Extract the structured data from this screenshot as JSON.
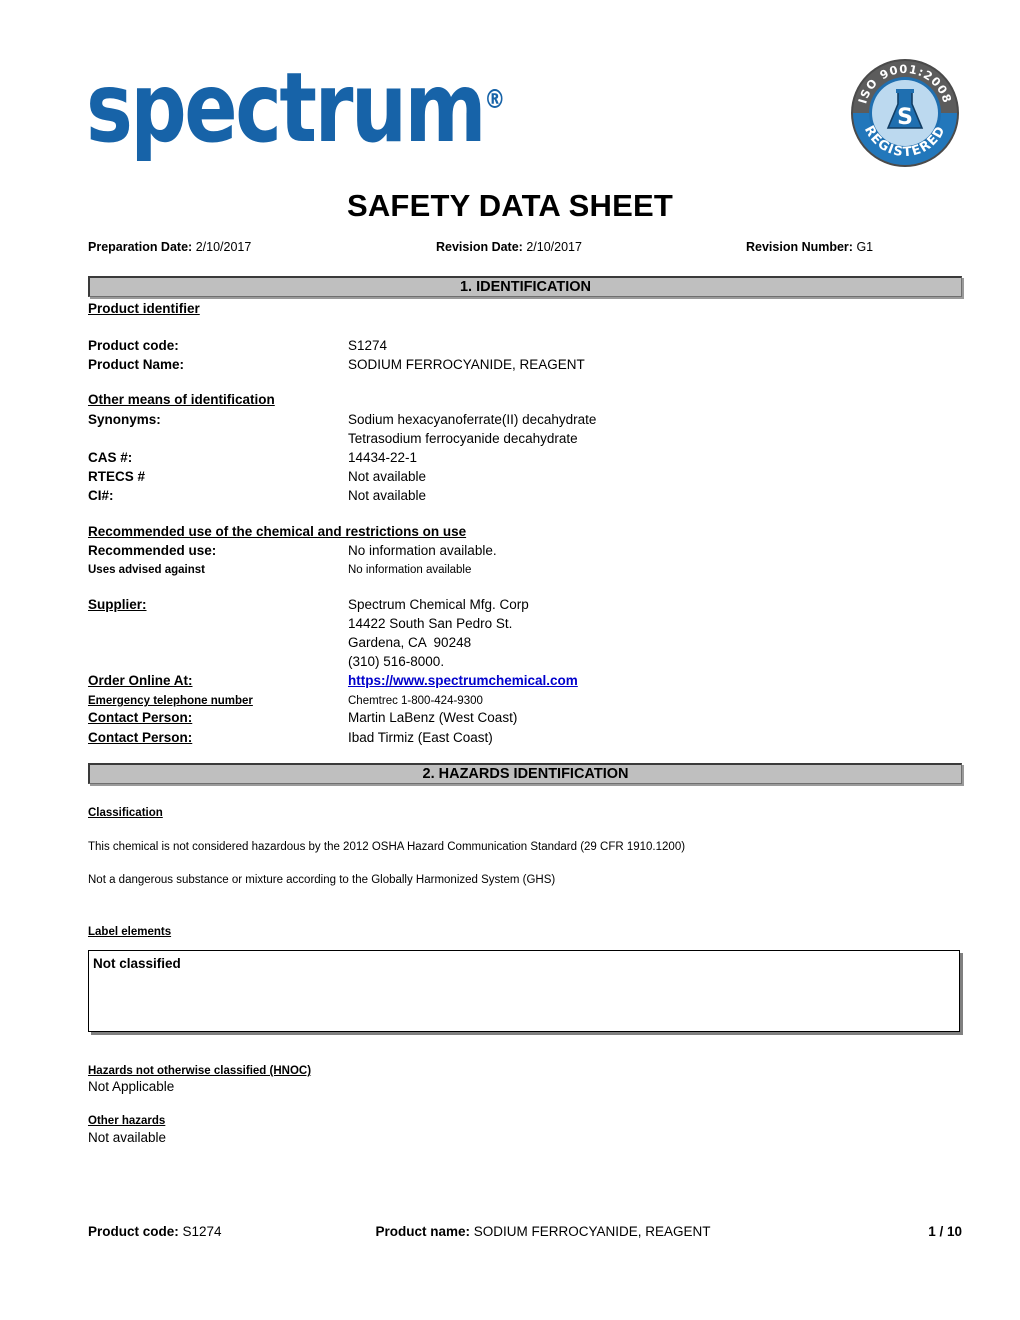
{
  "header": {
    "logo_text": "spectrum",
    "logo_registered_mark": "®",
    "iso_badge": {
      "top_text": "ISO 9001:2008",
      "bottom_text": "REGISTERED",
      "flask_letter": "S"
    }
  },
  "title": "SAFETY DATA SHEET",
  "meta": {
    "preparation_date_label": "Preparation Date:",
    "preparation_date_value": "2/10/2017",
    "revision_date_label": "Revision Date:",
    "revision_date_value": "2/10/2017",
    "revision_number_label": "Revision Number:",
    "revision_number_value": "G1"
  },
  "section1": {
    "heading": "1. IDENTIFICATION",
    "product_identifier_heading": "Product identifier",
    "product_code_label": "Product code:",
    "product_code_value": "S1274",
    "product_name_label": "Product Name:",
    "product_name_value": "SODIUM FERROCYANIDE, REAGENT",
    "other_means_heading": "Other means of identification",
    "synonyms_label": "Synonyms:",
    "synonyms_value_1": "Sodium hexacyanoferrate(II) decahydrate",
    "synonyms_value_2": "Tetrasodium ferrocyanide decahydrate",
    "cas_label": "CAS #:",
    "cas_value": "14434-22-1",
    "rtecs_label": "RTECS #",
    "rtecs_value": "Not available",
    "ci_label": "CI#:",
    "ci_value": "Not available",
    "recommended_use_heading": "Recommended use of the chemical and restrictions on use",
    "recommended_use_label": "Recommended use:",
    "recommended_use_value": "No information available.",
    "uses_advised_label": "Uses advised against",
    "uses_advised_value": "No information available",
    "supplier_label": "Supplier:",
    "supplier_line_1": "Spectrum Chemical Mfg. Corp",
    "supplier_line_2": "14422 South San Pedro St.",
    "supplier_line_3": "Gardena, CA  90248",
    "supplier_line_4": "(310) 516-8000.",
    "order_online_label": "Order Online At:",
    "order_online_value": "https://www.spectrumchemical.com",
    "emergency_phone_label": "Emergency telephone number",
    "emergency_phone_value": "Chemtrec 1-800-424-9300",
    "contact_person_label_1": "Contact Person:",
    "contact_person_value_1": "Martin LaBenz (West Coast)",
    "contact_person_label_2": "Contact Person:",
    "contact_person_value_2": "Ibad Tirmiz (East Coast)"
  },
  "section2": {
    "heading": "2. HAZARDS IDENTIFICATION",
    "classification_heading": "Classification",
    "classification_line_1": "This chemical is not considered hazardous by the 2012 OSHA Hazard Communication Standard (29 CFR 1910.1200)",
    "classification_line_2": "Not a dangerous substance or mixture according to the Globally Harmonized System (GHS)",
    "label_elements_heading": "Label elements",
    "label_elements_box_text": "Not classified",
    "hnoc_heading": "Hazards not otherwise classified (HNOC)",
    "hnoc_value": "Not Applicable",
    "other_hazards_heading": "Other hazards",
    "other_hazards_value": "Not available"
  },
  "footer": {
    "product_code_label": "Product code:",
    "product_code_value": "S1274",
    "product_name_label": "Product name:",
    "product_name_value": "SODIUM FERROCYANIDE, REAGENT",
    "page_number": "1 / 10"
  },
  "colors": {
    "logo_blue": "#1763A8",
    "link_blue": "#0000CC",
    "section_bar_gray": "#BFBFBF"
  }
}
